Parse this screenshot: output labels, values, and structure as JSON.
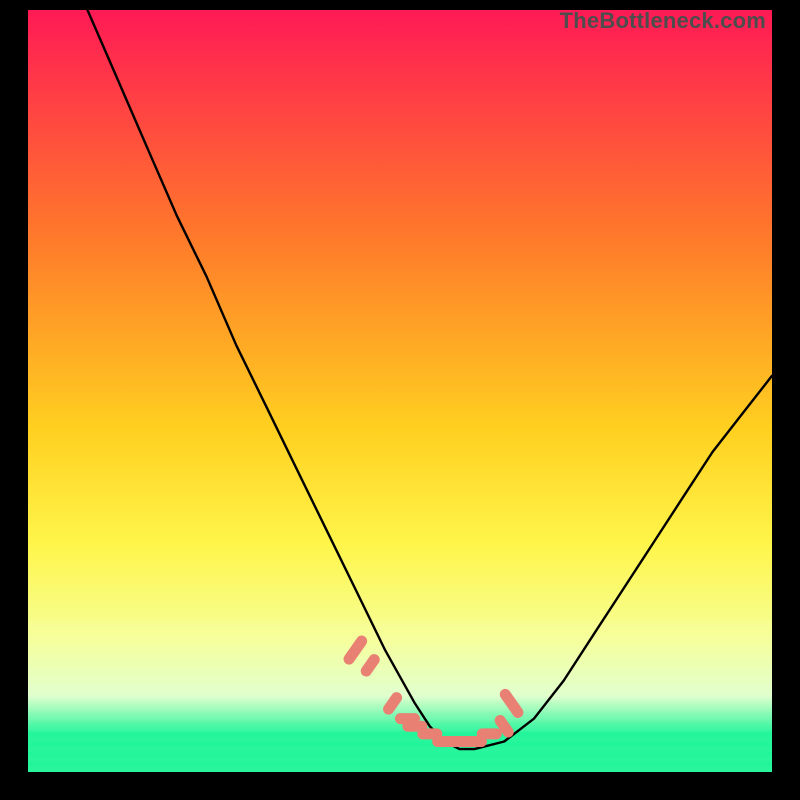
{
  "watermark": "TheBottleneck.com",
  "colors": {
    "top": "#ff1a55",
    "mid1": "#ff7a2a",
    "mid2": "#ffd020",
    "mid3": "#fff54a",
    "mid4": "#f5ff9a",
    "bottom_pale": "#dfffcb",
    "green": "#19f596",
    "curve": "#000000",
    "marker": "#e88074",
    "frame": "#000000"
  },
  "chart_data": {
    "type": "line",
    "title": "",
    "xlabel": "",
    "ylabel": "",
    "xlim": [
      0,
      100
    ],
    "ylim": [
      0,
      100
    ],
    "gradient_bands": [
      {
        "y": 0,
        "color": "#ff1a55"
      },
      {
        "y": 30,
        "color": "#ff7a2a"
      },
      {
        "y": 55,
        "color": "#ffd020"
      },
      {
        "y": 70,
        "color": "#fff54a"
      },
      {
        "y": 83,
        "color": "#f5ff9a"
      },
      {
        "y": 90,
        "color": "#dfffcb"
      },
      {
        "y": 95,
        "color": "#19f596"
      },
      {
        "y": 100,
        "color": "#19f596"
      }
    ],
    "series": [
      {
        "name": "bottleneck-curve",
        "x": [
          8,
          12,
          16,
          20,
          24,
          28,
          32,
          36,
          40,
          44,
          48,
          52,
          54,
          56,
          58,
          60,
          64,
          68,
          72,
          76,
          80,
          84,
          88,
          92,
          96,
          100
        ],
        "y": [
          100,
          91,
          82,
          73,
          65,
          56,
          48,
          40,
          32,
          24,
          16,
          9,
          6,
          4,
          3,
          3,
          4,
          7,
          12,
          18,
          24,
          30,
          36,
          42,
          47,
          52
        ]
      }
    ],
    "markers": {
      "name": "highlight-region",
      "color": "#e88074",
      "points": [
        {
          "x": 44,
          "y": 16
        },
        {
          "x": 46,
          "y": 14
        },
        {
          "x": 49,
          "y": 9
        },
        {
          "x": 51,
          "y": 7
        },
        {
          "x": 52,
          "y": 6
        },
        {
          "x": 54,
          "y": 5
        },
        {
          "x": 56,
          "y": 4
        },
        {
          "x": 58,
          "y": 4
        },
        {
          "x": 60,
          "y": 4
        },
        {
          "x": 62,
          "y": 5
        },
        {
          "x": 64,
          "y": 6
        },
        {
          "x": 65,
          "y": 9
        }
      ]
    }
  }
}
